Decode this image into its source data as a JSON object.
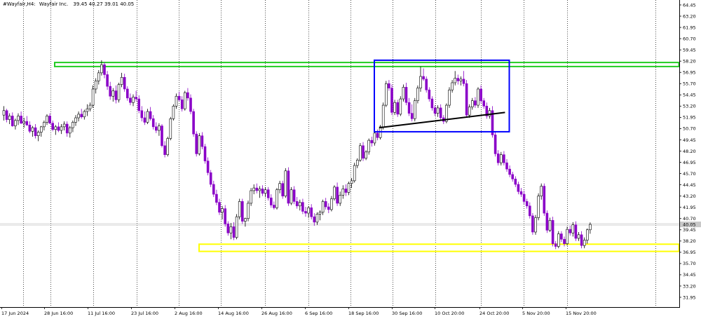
{
  "header": {
    "symbol": "#Wayfair,H4:",
    "name": "Wayfair Inc.",
    "ohlc": "39.45 40.27 39.01 40.05"
  },
  "colors": {
    "background": "#ffffff",
    "bull_body": "#ffffff",
    "bull_border": "#000000",
    "bear_body": "#8a00c8",
    "bear_wick": "#8a00c8",
    "resistance_zone": "#22cc22",
    "support_zone": "#ffff00",
    "range_box": "#0000ff",
    "trendline": "#000000",
    "grid": "#000000"
  },
  "chart_data": {
    "type": "candlestick",
    "title": "Wayfair Inc. H4",
    "ylim": [
      30.7,
      65.7
    ],
    "y_ticks": [
      "64.45",
      "63.20",
      "61.95",
      "60.70",
      "59.45",
      "58.20",
      "56.95",
      "55.70",
      "54.45",
      "53.20",
      "51.95",
      "50.70",
      "49.45",
      "48.20",
      "46.95",
      "45.70",
      "44.45",
      "43.20",
      "41.95",
      "40.70",
      "39.45",
      "38.20",
      "36.95",
      "35.70",
      "34.45",
      "33.20",
      "31.95"
    ],
    "x_labels": [
      "17 Jun 2024",
      "28 Jun 16:00",
      "11 Jul 16:00",
      "23 Jul 16:00",
      "2 Aug 16:00",
      "14 Aug 16:00",
      "26 Aug 16:00",
      "6 Sep 16:00",
      "18 Sep 16:00",
      "30 Sep 16:00",
      "10 Oct 20:00",
      "24 Oct 20:00",
      "5 Nov 20:00",
      "15 Nov 20:00"
    ],
    "grid": "vertical dotted",
    "current_price": 40.05,
    "candles": [
      [
        52.2,
        53.2,
        51.6,
        52.7
      ],
      [
        52.7,
        52.9,
        51.4,
        51.7
      ],
      [
        51.7,
        52.4,
        51.2,
        52.1
      ],
      [
        52.1,
        52.5,
        50.9,
        51.0
      ],
      [
        51.0,
        51.8,
        50.6,
        51.6
      ],
      [
        51.6,
        52.4,
        51.1,
        52.1
      ],
      [
        52.1,
        52.6,
        51.2,
        51.3
      ],
      [
        51.3,
        51.9,
        50.8,
        51.5
      ],
      [
        51.5,
        52.1,
        51.0,
        51.1
      ],
      [
        51.1,
        51.5,
        50.2,
        50.4
      ],
      [
        50.4,
        51.0,
        49.8,
        50.8
      ],
      [
        50.8,
        51.2,
        49.6,
        49.9
      ],
      [
        49.9,
        50.5,
        49.3,
        50.3
      ],
      [
        50.3,
        51.0,
        49.8,
        50.9
      ],
      [
        50.9,
        51.6,
        50.5,
        51.4
      ],
      [
        51.4,
        52.3,
        51.1,
        52.1
      ],
      [
        52.1,
        52.4,
        51.2,
        51.3
      ],
      [
        51.3,
        51.6,
        50.4,
        50.6
      ],
      [
        50.6,
        51.1,
        50.0,
        50.9
      ],
      [
        50.9,
        51.4,
        50.3,
        50.5
      ],
      [
        50.5,
        51.2,
        50.1,
        50.9
      ],
      [
        50.9,
        51.5,
        50.5,
        51.2
      ],
      [
        51.2,
        51.5,
        49.8,
        50.2
      ],
      [
        50.2,
        51.0,
        49.7,
        50.8
      ],
      [
        50.8,
        51.6,
        50.3,
        51.4
      ],
      [
        51.4,
        52.2,
        51.0,
        51.9
      ],
      [
        51.9,
        52.6,
        51.5,
        52.3
      ],
      [
        52.3,
        52.9,
        51.8,
        52.0
      ],
      [
        52.0,
        52.8,
        51.7,
        52.6
      ],
      [
        52.6,
        53.4,
        52.1,
        52.9
      ],
      [
        52.9,
        53.6,
        52.6,
        53.3
      ],
      [
        53.3,
        55.5,
        53.0,
        55.1
      ],
      [
        55.1,
        56.3,
        54.6,
        56.0
      ],
      [
        56.0,
        57.2,
        55.6,
        56.9
      ],
      [
        56.9,
        58.3,
        56.6,
        57.8
      ],
      [
        57.8,
        58.1,
        56.3,
        56.7
      ],
      [
        56.7,
        57.1,
        55.0,
        55.4
      ],
      [
        55.4,
        55.9,
        53.9,
        54.3
      ],
      [
        54.3,
        55.2,
        53.7,
        54.9
      ],
      [
        54.9,
        55.5,
        53.5,
        53.9
      ],
      [
        53.9,
        55.8,
        53.6,
        55.6
      ],
      [
        55.6,
        56.9,
        55.3,
        56.4
      ],
      [
        56.4,
        56.8,
        54.8,
        55.1
      ],
      [
        55.1,
        55.4,
        53.8,
        54.1
      ],
      [
        54.1,
        54.6,
        53.3,
        53.6
      ],
      [
        53.6,
        54.5,
        53.2,
        54.2
      ],
      [
        54.2,
        54.9,
        53.7,
        54.0
      ],
      [
        54.0,
        54.4,
        52.4,
        52.7
      ],
      [
        52.7,
        53.2,
        51.5,
        51.9
      ],
      [
        51.9,
        52.6,
        51.1,
        51.4
      ],
      [
        51.4,
        52.9,
        51.2,
        52.6
      ],
      [
        52.6,
        53.1,
        51.6,
        51.8
      ],
      [
        51.8,
        52.2,
        50.6,
        50.9
      ],
      [
        50.9,
        51.4,
        50.2,
        50.5
      ],
      [
        50.5,
        51.3,
        49.9,
        51.0
      ],
      [
        51.0,
        51.2,
        48.6,
        48.8
      ],
      [
        48.8,
        49.3,
        47.5,
        47.8
      ],
      [
        47.8,
        49.8,
        47.6,
        49.6
      ],
      [
        49.6,
        52.0,
        49.4,
        51.8
      ],
      [
        51.8,
        53.4,
        51.6,
        53.2
      ],
      [
        53.2,
        54.6,
        52.9,
        54.3
      ],
      [
        54.3,
        54.8,
        53.7,
        53.9
      ],
      [
        53.9,
        54.3,
        52.6,
        52.9
      ],
      [
        52.9,
        54.9,
        52.7,
        54.7
      ],
      [
        54.7,
        55.2,
        53.8,
        54.1
      ],
      [
        54.1,
        54.5,
        52.3,
        52.6
      ],
      [
        52.6,
        52.9,
        49.8,
        50.1
      ],
      [
        50.1,
        50.4,
        47.6,
        47.9
      ],
      [
        47.9,
        50.2,
        47.7,
        49.9
      ],
      [
        49.9,
        50.3,
        48.4,
        48.7
      ],
      [
        48.7,
        49.0,
        46.8,
        47.1
      ],
      [
        47.1,
        47.5,
        45.5,
        45.8
      ],
      [
        45.8,
        46.1,
        44.2,
        44.5
      ],
      [
        44.5,
        44.9,
        43.1,
        43.4
      ],
      [
        43.4,
        43.9,
        42.2,
        42.5
      ],
      [
        42.5,
        42.9,
        41.1,
        41.4
      ],
      [
        41.4,
        42.1,
        40.6,
        41.8
      ],
      [
        41.8,
        42.2,
        39.8,
        40.1
      ],
      [
        40.1,
        40.4,
        38.8,
        39.1
      ],
      [
        39.1,
        40.2,
        38.4,
        39.8
      ],
      [
        39.8,
        40.3,
        38.3,
        38.6
      ],
      [
        38.6,
        41.2,
        38.4,
        40.9
      ],
      [
        40.9,
        42.9,
        40.6,
        42.6
      ],
      [
        42.6,
        42.9,
        40.1,
        40.4
      ],
      [
        40.4,
        40.8,
        39.8,
        40.7
      ],
      [
        40.7,
        42.7,
        40.4,
        42.4
      ],
      [
        42.4,
        44.1,
        42.1,
        43.8
      ],
      [
        43.8,
        44.5,
        43.4,
        44.1
      ],
      [
        44.1,
        44.6,
        43.5,
        43.8
      ],
      [
        43.8,
        44.3,
        43.0,
        44.0
      ],
      [
        44.0,
        44.4,
        43.2,
        43.5
      ],
      [
        43.5,
        44.2,
        43.1,
        43.9
      ],
      [
        43.9,
        44.2,
        42.7,
        43.0
      ],
      [
        43.0,
        43.4,
        41.9,
        42.2
      ],
      [
        42.2,
        42.6,
        41.7,
        41.9
      ],
      [
        41.9,
        44.1,
        41.7,
        43.9
      ],
      [
        43.9,
        44.9,
        43.5,
        44.6
      ],
      [
        44.6,
        44.9,
        42.9,
        43.2
      ],
      [
        43.2,
        46.3,
        43.0,
        46.0
      ],
      [
        46.0,
        46.4,
        42.1,
        42.4
      ],
      [
        42.4,
        44.2,
        42.2,
        43.9
      ],
      [
        43.9,
        44.3,
        42.3,
        42.6
      ],
      [
        42.6,
        43.1,
        41.8,
        42.1
      ],
      [
        42.1,
        42.8,
        41.6,
        42.5
      ],
      [
        42.5,
        42.9,
        41.2,
        41.5
      ],
      [
        41.5,
        42.0,
        40.9,
        41.3
      ],
      [
        41.3,
        42.1,
        40.8,
        41.9
      ],
      [
        41.9,
        42.3,
        40.6,
        40.9
      ],
      [
        40.9,
        41.3,
        39.9,
        40.3
      ],
      [
        40.3,
        41.4,
        40.0,
        41.2
      ],
      [
        41.2,
        41.6,
        40.5,
        41.4
      ],
      [
        41.4,
        42.8,
        41.1,
        42.6
      ],
      [
        42.6,
        43.0,
        41.7,
        42.0
      ],
      [
        42.0,
        42.4,
        41.3,
        41.7
      ],
      [
        41.7,
        43.2,
        41.5,
        42.9
      ],
      [
        42.9,
        44.4,
        42.7,
        44.2
      ],
      [
        44.2,
        44.7,
        42.1,
        42.4
      ],
      [
        42.4,
        43.7,
        42.1,
        43.3
      ],
      [
        43.3,
        44.4,
        42.9,
        44.0
      ],
      [
        44.0,
        44.5,
        43.2,
        43.6
      ],
      [
        43.6,
        44.8,
        43.3,
        44.6
      ],
      [
        44.6,
        45.2,
        44.1,
        44.9
      ],
      [
        44.9,
        46.9,
        44.7,
        46.6
      ],
      [
        46.6,
        47.4,
        46.3,
        47.2
      ],
      [
        47.2,
        49.1,
        47.0,
        48.8
      ],
      [
        48.8,
        49.2,
        47.1,
        47.4
      ],
      [
        47.4,
        48.3,
        47.2,
        48.1
      ],
      [
        48.1,
        49.6,
        47.8,
        49.4
      ],
      [
        49.4,
        49.8,
        48.7,
        49.1
      ],
      [
        49.1,
        50.4,
        48.8,
        50.2
      ],
      [
        50.2,
        50.6,
        49.4,
        49.7
      ],
      [
        49.7,
        51.1,
        49.5,
        50.9
      ],
      [
        50.9,
        53.6,
        50.6,
        53.3
      ],
      [
        53.3,
        56.0,
        53.1,
        55.7
      ],
      [
        55.7,
        56.1,
        54.9,
        55.2
      ],
      [
        55.2,
        55.6,
        52.2,
        52.5
      ],
      [
        52.5,
        53.9,
        52.2,
        53.6
      ],
      [
        53.6,
        53.9,
        52.0,
        52.3
      ],
      [
        52.3,
        54.3,
        52.1,
        54.0
      ],
      [
        54.0,
        55.6,
        53.7,
        55.3
      ],
      [
        55.3,
        55.8,
        53.3,
        53.6
      ],
      [
        53.6,
        54.1,
        52.1,
        52.4
      ],
      [
        52.4,
        53.4,
        51.5,
        51.8
      ],
      [
        51.8,
        54.1,
        51.5,
        53.8
      ],
      [
        53.8,
        55.5,
        53.5,
        55.2
      ],
      [
        55.2,
        57.6,
        54.8,
        56.5
      ],
      [
        56.5,
        57.4,
        56.0,
        56.2
      ],
      [
        56.2,
        56.5,
        54.7,
        55.0
      ],
      [
        55.0,
        55.3,
        53.7,
        54.0
      ],
      [
        54.0,
        54.3,
        52.7,
        53.0
      ],
      [
        53.0,
        53.3,
        52.1,
        52.4
      ],
      [
        52.4,
        53.3,
        52.0,
        53.0
      ],
      [
        53.0,
        53.4,
        51.6,
        51.9
      ],
      [
        51.9,
        52.2,
        51.2,
        51.5
      ],
      [
        51.5,
        53.5,
        51.3,
        53.3
      ],
      [
        53.3,
        55.3,
        53.0,
        55.0
      ],
      [
        55.0,
        56.1,
        54.7,
        55.8
      ],
      [
        55.8,
        57.1,
        55.5,
        56.3
      ],
      [
        56.3,
        56.7,
        55.6,
        56.0
      ],
      [
        56.0,
        56.5,
        55.5,
        56.2
      ],
      [
        56.2,
        57.1,
        55.4,
        55.7
      ],
      [
        55.7,
        56.1,
        51.9,
        52.2
      ],
      [
        52.2,
        53.4,
        51.9,
        53.1
      ],
      [
        53.1,
        54.1,
        52.8,
        53.8
      ],
      [
        53.8,
        54.2,
        53.0,
        53.3
      ],
      [
        53.3,
        55.3,
        53.0,
        55.1
      ],
      [
        55.1,
        55.5,
        53.5,
        53.8
      ],
      [
        53.8,
        54.1,
        52.9,
        53.2
      ],
      [
        53.2,
        53.6,
        51.8,
        52.1
      ],
      [
        52.1,
        53.0,
        51.8,
        52.7
      ],
      [
        52.7,
        53.2,
        49.7,
        50.0
      ],
      [
        50.0,
        50.4,
        47.6,
        47.9
      ],
      [
        47.9,
        48.3,
        46.6,
        46.9
      ],
      [
        46.9,
        48.1,
        46.6,
        47.8
      ],
      [
        47.8,
        48.2,
        46.6,
        46.9
      ],
      [
        46.9,
        47.3,
        45.9,
        46.2
      ],
      [
        46.2,
        46.6,
        45.3,
        45.6
      ],
      [
        45.6,
        45.9,
        44.8,
        45.1
      ],
      [
        45.1,
        45.4,
        44.2,
        44.5
      ],
      [
        44.5,
        44.8,
        43.4,
        43.7
      ],
      [
        43.7,
        44.1,
        43.1,
        43.4
      ],
      [
        43.4,
        43.8,
        42.3,
        42.6
      ],
      [
        42.6,
        42.9,
        41.8,
        42.1
      ],
      [
        42.1,
        42.5,
        40.7,
        41.0
      ],
      [
        41.0,
        41.3,
        38.9,
        39.2
      ],
      [
        39.2,
        41.1,
        38.9,
        40.8
      ],
      [
        40.8,
        43.5,
        40.5,
        43.2
      ],
      [
        43.2,
        44.6,
        42.8,
        44.3
      ],
      [
        44.3,
        44.6,
        41.0,
        41.3
      ],
      [
        41.3,
        41.6,
        39.1,
        39.4
      ],
      [
        39.4,
        40.8,
        39.2,
        40.5
      ],
      [
        40.5,
        40.9,
        37.6,
        37.9
      ],
      [
        37.9,
        38.2,
        37.3,
        37.6
      ],
      [
        37.6,
        39.3,
        37.4,
        39.0
      ],
      [
        39.0,
        39.3,
        38.1,
        38.4
      ],
      [
        38.4,
        38.7,
        37.6,
        37.9
      ],
      [
        37.9,
        39.8,
        37.7,
        39.5
      ],
      [
        39.5,
        39.9,
        38.8,
        39.1
      ],
      [
        39.1,
        40.3,
        38.7,
        40.0
      ],
      [
        40.0,
        40.4,
        38.2,
        38.5
      ],
      [
        38.5,
        39.2,
        38.2,
        38.9
      ],
      [
        38.9,
        39.3,
        37.4,
        37.7
      ],
      [
        37.7,
        38.6,
        37.4,
        38.3
      ],
      [
        38.3,
        39.6,
        37.9,
        39.45
      ],
      [
        39.45,
        40.27,
        39.01,
        40.05
      ]
    ],
    "zones": [
      {
        "name": "resistance-zone",
        "low": 57.6,
        "high": 58.05,
        "color": "#22cc22",
        "x_from": "28 Jun 16:00"
      },
      {
        "name": "support-zone",
        "low": 37.05,
        "high": 37.85,
        "color": "#ffff00",
        "x_from": "2 Aug 16:00"
      }
    ],
    "range_box": {
      "low": 50.35,
      "high": 58.3,
      "color": "#0000ff",
      "from_candle": 130,
      "to_candle": 175
    },
    "trendline": {
      "from_candle": 131,
      "from_price": 50.8,
      "to_candle": 174,
      "to_price": 52.5
    }
  }
}
